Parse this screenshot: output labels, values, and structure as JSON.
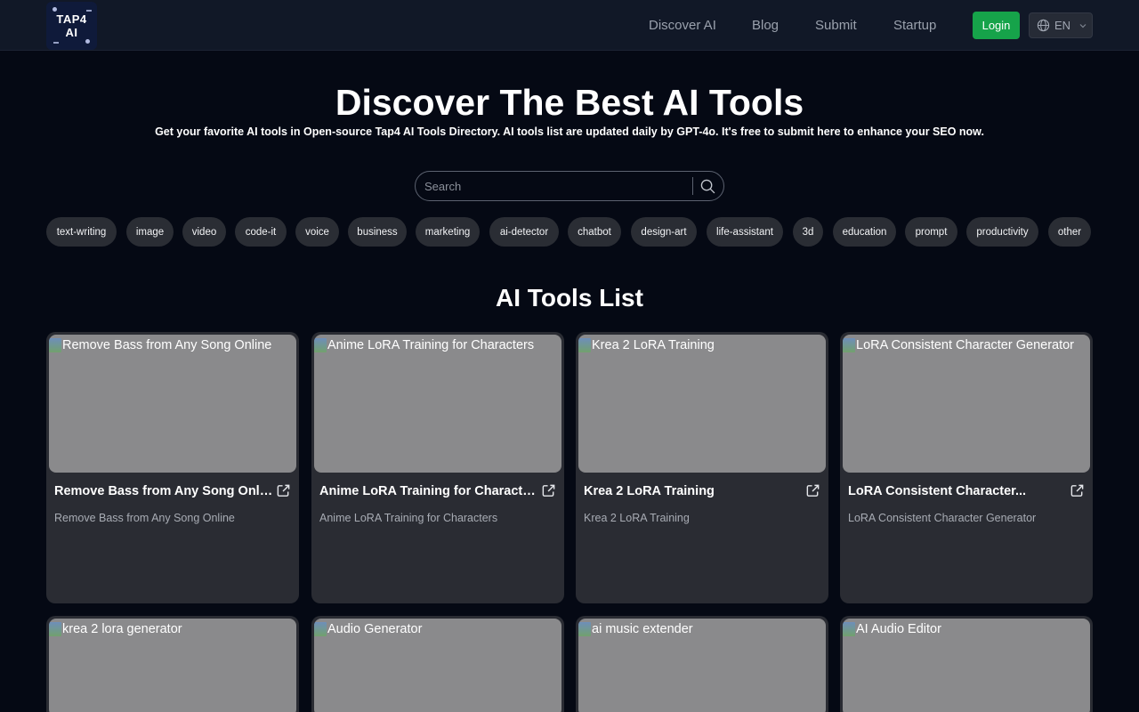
{
  "header": {
    "logo_line1": "TAP4",
    "logo_line2": "AI",
    "nav": [
      "Discover AI",
      "Blog",
      "Submit",
      "Startup"
    ],
    "login_label": "Login",
    "language": "EN"
  },
  "hero": {
    "title": "Discover The Best AI Tools",
    "subtitle": "Get your favorite AI tools in Open-source Tap4 AI Tools Directory. AI tools list are updated daily by GPT-4o. It's free to submit here to enhance your SEO now."
  },
  "search": {
    "placeholder": "Search"
  },
  "tags": [
    "text-writing",
    "image",
    "video",
    "code-it",
    "voice",
    "business",
    "marketing",
    "ai-detector",
    "chatbot",
    "design-art",
    "life-assistant",
    "3d",
    "education",
    "prompt",
    "productivity",
    "other"
  ],
  "list_title": "AI Tools List",
  "cards": [
    {
      "alt": "Remove Bass from Any Song Online",
      "name": "Remove Bass from Any Song Online",
      "desc": "Remove Bass from Any Song Online"
    },
    {
      "alt": "Anime LoRA Training for Characters",
      "name": "Anime LoRA Training for Characters",
      "desc": "Anime LoRA Training for Characters"
    },
    {
      "alt": "Krea 2 LoRA Training",
      "name": "Krea 2 LoRA Training",
      "desc": "Krea 2 LoRA Training"
    },
    {
      "alt": "LoRA Consistent Character Generator",
      "name": "LoRA Consistent Character...",
      "desc": "LoRA Consistent Character Generator"
    },
    {
      "alt": "krea 2 lora generator",
      "name": "",
      "desc": ""
    },
    {
      "alt": "Audio Generator",
      "name": "",
      "desc": ""
    },
    {
      "alt": "ai music extender",
      "name": "",
      "desc": ""
    },
    {
      "alt": "AI Audio Editor",
      "name": "",
      "desc": ""
    }
  ],
  "colors": {
    "background": "#050914",
    "header": "#111827",
    "accent_green": "#16a34a",
    "card": "#2a2c33",
    "thumb_placeholder": "#8a8a8c",
    "tag": "#2a2d34"
  },
  "icons": [
    "globe-icon",
    "chevron-down-icon",
    "search-icon",
    "external-link-icon",
    "broken-image-icon"
  ]
}
